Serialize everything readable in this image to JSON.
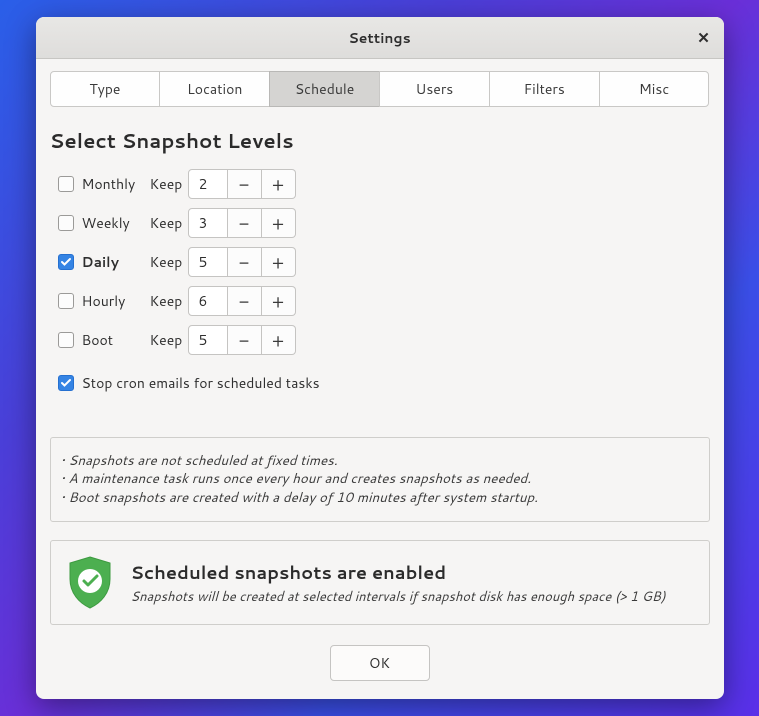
{
  "title": "Settings",
  "tabs": {
    "type": "Type",
    "location": "Location",
    "schedule": "Schedule",
    "users": "Users",
    "filters": "Filters",
    "misc": "Misc"
  },
  "heading": "Select Snapshot Levels",
  "keep_label": "Keep",
  "levels": {
    "monthly": {
      "label": "Monthly",
      "value": "2",
      "checked": false
    },
    "weekly": {
      "label": "Weekly",
      "value": "3",
      "checked": false
    },
    "daily": {
      "label": "Daily",
      "value": "5",
      "checked": true
    },
    "hourly": {
      "label": "Hourly",
      "value": "6",
      "checked": false
    },
    "boot": {
      "label": "Boot",
      "value": "5",
      "checked": false
    }
  },
  "cron": {
    "label": "Stop cron emails for scheduled tasks",
    "checked": true
  },
  "info": {
    "l1": "• Snapshots are not scheduled at fixed times.",
    "l2": "• A maintenance task runs once every hour and creates snapshots as needed.",
    "l3": "• Boot snapshots are created with a delay of 10 minutes after system startup."
  },
  "status": {
    "title": "Scheduled snapshots are enabled",
    "sub": "Snapshots will be created at selected intervals if snapshot disk has enough space (> 1 GB)"
  },
  "ok": "OK"
}
